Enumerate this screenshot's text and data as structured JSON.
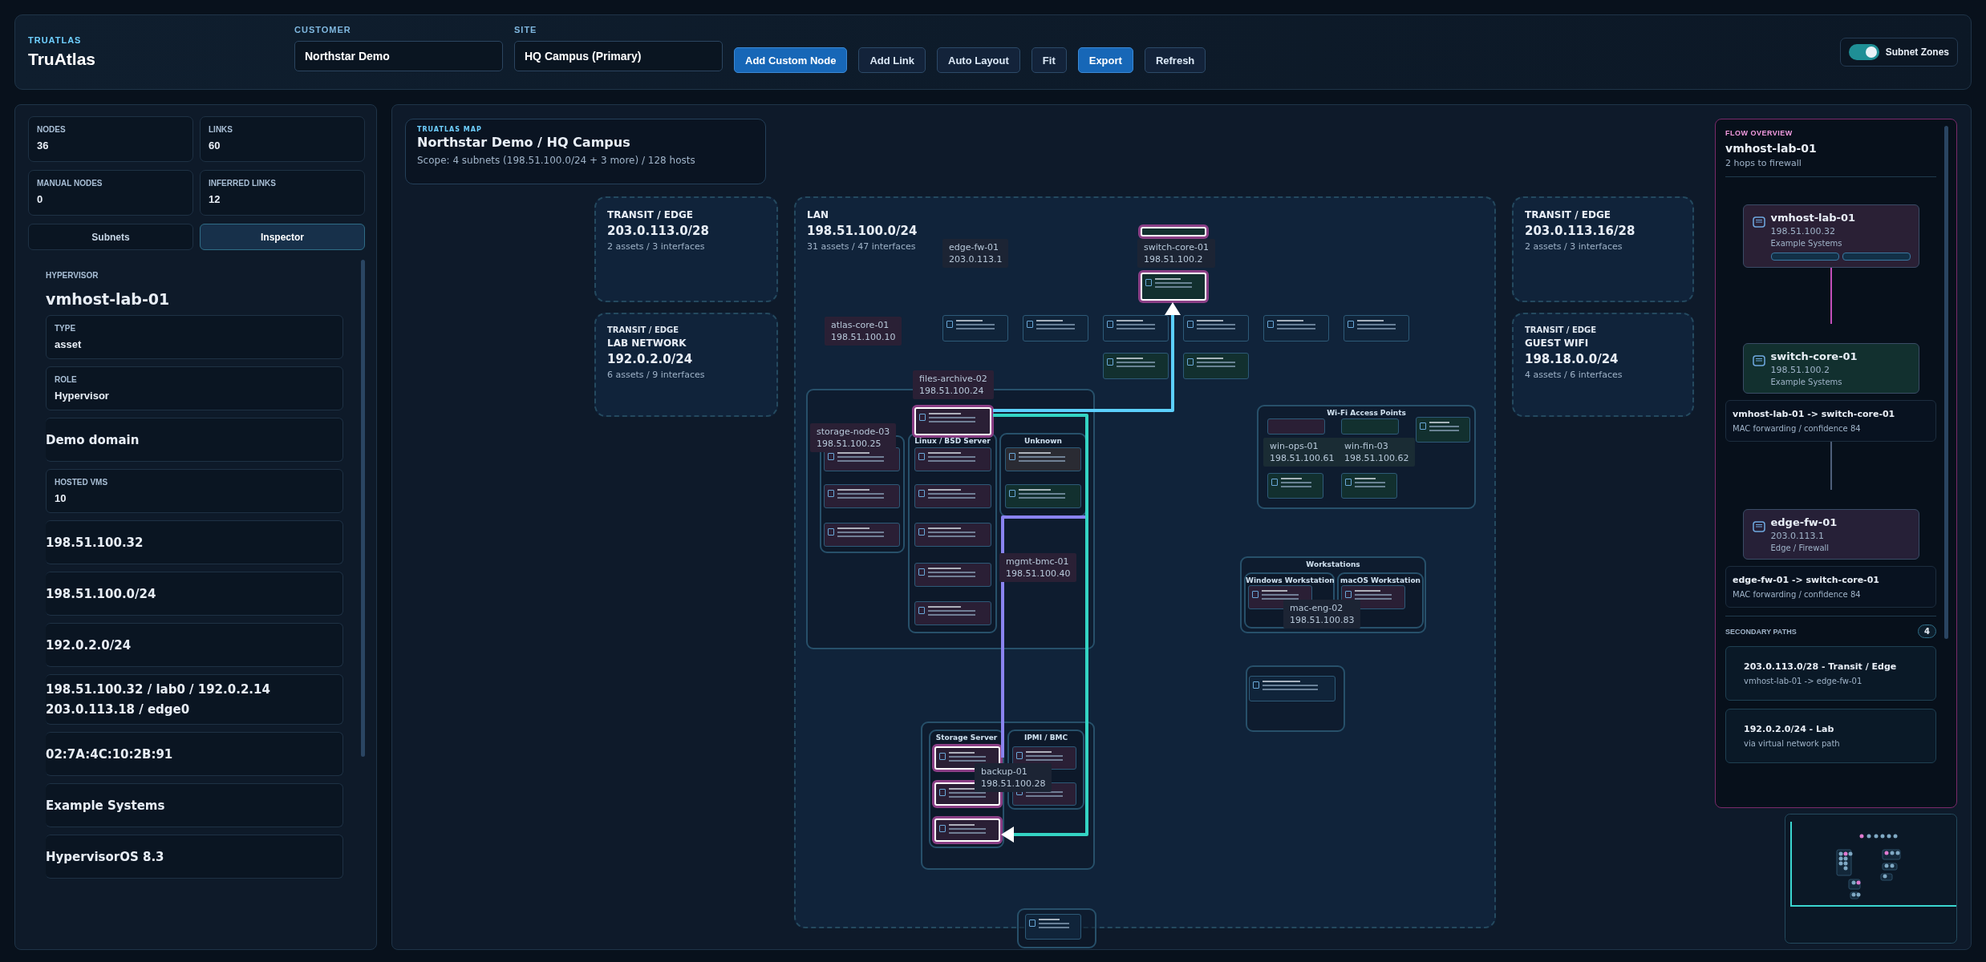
{
  "app": {
    "brand": "TRUATLAS",
    "title": "TruAtlas"
  },
  "filters": [
    {
      "label": "CUSTOMER",
      "value": "Northstar Demo"
    },
    {
      "label": "SITE",
      "value": "HQ Campus (Primary)"
    }
  ],
  "toolbar": [
    {
      "label": "Add Custom Node",
      "primary": true
    },
    {
      "label": "Add Link",
      "primary": false
    },
    {
      "label": "Auto Layout",
      "primary": false
    },
    {
      "label": "Fit",
      "primary": false
    },
    {
      "label": "Export",
      "primary": true
    },
    {
      "label": "Refresh",
      "primary": false
    }
  ],
  "subnet_zones": {
    "label": "Subnet Zones",
    "on": true
  },
  "stats": [
    {
      "label": "NODES",
      "value": "36"
    },
    {
      "label": "LINKS",
      "value": "60"
    },
    {
      "label": "MANUAL NODES",
      "value": "0"
    },
    {
      "label": "INFERRED LINKS",
      "value": "12"
    }
  ],
  "panel_tabs": [
    {
      "label": "Subnets",
      "selected": false
    },
    {
      "label": "Inspector",
      "selected": true
    }
  ],
  "inspector": {
    "kind_label": "HYPERVISOR",
    "name": "vmhost-lab-01",
    "fields": [
      {
        "label": "TYPE",
        "values": [
          "asset"
        ]
      },
      {
        "label": "ROLE",
        "values": [
          "Hypervisor"
        ]
      },
      {
        "values": [
          "Demo domain"
        ]
      },
      {
        "label": "HOSTED VMS",
        "values": [
          "10"
        ]
      },
      {
        "values": [
          "198.51.100.32"
        ]
      },
      {
        "values": [
          "198.51.100.0/24"
        ]
      },
      {
        "values": [
          "192.0.2.0/24"
        ]
      },
      {
        "values": [
          "198.51.100.32 / lab0 / 192.0.2.14",
          "203.0.113.18 / edge0"
        ]
      },
      {
        "values": [
          "02:7A:4C:10:2B:91"
        ]
      },
      {
        "values": [
          "Example Systems"
        ]
      },
      {
        "values": [
          "HypervisorOS 8.3"
        ]
      }
    ]
  },
  "map": {
    "header": {
      "eyebrow": "TRUATLAS MAP",
      "title": "Northstar Demo / HQ Campus",
      "scope": "Scope: 4 subnets (198.51.100.0/24 + 3 more) / 128 hosts"
    },
    "zones": [
      {
        "tag": "TRANSIT / EDGE",
        "network": "203.0.113.0/28",
        "summary": "2 assets / 3 interfaces"
      },
      {
        "overlay_tag": "TRANSIT / EDGE",
        "tag": "LAB NETWORK",
        "network": "192.0.2.0/24",
        "summary": "6 assets / 9 interfaces"
      },
      {
        "tag": "LAN",
        "network": "198.51.100.0/24",
        "summary": "31 assets / 47 interfaces"
      },
      {
        "tag": "TRANSIT / EDGE",
        "network": "203.0.113.16/28",
        "summary": "2 assets / 3 interfaces"
      },
      {
        "overlay_tag": "TRANSIT / EDGE",
        "tag": "GUEST WIFI",
        "network": "198.18.0.0/24",
        "summary": "4 assets / 6 interfaces"
      }
    ],
    "groups": [
      {
        "kind": "frame"
      },
      {
        "kind": "frame"
      },
      {
        "kind": "titled",
        "title": "Linux / BSD Server"
      },
      {
        "kind": "titled",
        "title": "Unknown"
      },
      {
        "kind": "titled",
        "title": "Wi-Fi Access Points"
      },
      {
        "kind": "titled",
        "title": "Workstations"
      },
      {
        "kind": "titled",
        "title": "Windows Workstation"
      },
      {
        "kind": "titled",
        "title": "macOS Workstation"
      },
      {
        "kind": "frame"
      },
      {
        "kind": "frame"
      },
      {
        "kind": "titled",
        "title": "Storage Server"
      },
      {
        "kind": "titled",
        "title": "IPMI / BMC"
      },
      {
        "kind": "frame"
      }
    ],
    "devices": [
      {
        "color": "#12302f",
        "highlighted": true
      },
      {
        "color": "#12302f",
        "highlighted": true
      },
      {
        "color": "#10243a",
        "highlighted": false
      },
      {
        "color": "#10243a",
        "highlighted": false
      },
      {
        "color": "#10243a",
        "highlighted": false
      },
      {
        "color": "#10243a",
        "highlighted": false
      },
      {
        "color": "#10243a",
        "highlighted": false
      },
      {
        "color": "#10243a",
        "highlighted": false
      },
      {
        "color": "#12302f",
        "highlighted": false
      },
      {
        "color": "#12302f",
        "highlighted": false
      },
      {
        "color": "#2a1f35",
        "highlighted": true
      },
      {
        "color": "#2a1f35",
        "highlighted": false
      },
      {
        "color": "#2a1f35",
        "highlighted": false
      },
      {
        "color": "#2a1f35",
        "highlighted": false
      },
      {
        "color": "#2a1f35",
        "highlighted": false
      },
      {
        "color": "#2a1f35",
        "highlighted": false
      },
      {
        "color": "#2a1f35",
        "highlighted": false
      },
      {
        "color": "#2a1f35",
        "highlighted": false
      },
      {
        "color": "#2a1f35",
        "highlighted": false
      },
      {
        "color": "#2a2b33",
        "highlighted": false
      },
      {
        "color": "#12302f",
        "highlighted": false
      },
      {
        "color": "#2a1f35",
        "highlighted": false
      },
      {
        "color": "#12302f",
        "highlighted": false
      },
      {
        "color": "#12302f",
        "highlighted": false
      },
      {
        "color": "#12302f",
        "highlighted": false
      },
      {
        "color": "#12302f",
        "highlighted": false
      },
      {
        "color": "#2a1f35",
        "highlighted": false
      },
      {
        "color": "#2a1f35",
        "highlighted": false
      },
      {
        "color": "#10243a",
        "highlighted": false
      },
      {
        "color": "#2a1f35",
        "highlighted": true
      },
      {
        "color": "#2a1f35",
        "highlighted": true
      },
      {
        "color": "#2a1f35",
        "highlighted": true
      },
      {
        "color": "#2a1f35",
        "highlighted": false
      },
      {
        "color": "#2a1f35",
        "highlighted": false
      },
      {
        "color": "#10243a",
        "highlighted": false
      }
    ],
    "tooltips": [
      {
        "name": "edge-fw-01",
        "ip": "203.0.113.1",
        "color": "#1c2434"
      },
      {
        "name": "switch-core-01",
        "ip": "198.51.100.2",
        "color": "#1c2434"
      },
      {
        "name": "atlas-core-01",
        "ip": "198.51.100.10",
        "color": "#2a2035"
      },
      {
        "name": "files-archive-02",
        "ip": "198.51.100.24",
        "color": "#2a2035"
      },
      {
        "name": "storage-node-03",
        "ip": "198.51.100.25",
        "color": "#2a2035"
      },
      {
        "name": "mgmt-bmc-01",
        "ip": "198.51.100.40",
        "color": "#2a2035"
      },
      {
        "name": "win-ops-01",
        "ip": "198.51.100.61",
        "color": "#1a2c34"
      },
      {
        "name": "win-fin-03",
        "ip": "198.51.100.62",
        "color": "#1a2c34"
      },
      {
        "name": "mac-eng-02",
        "ip": "198.51.100.83",
        "color": "#1c2434"
      },
      {
        "name": "backup-01",
        "ip": "198.51.100.28",
        "color": "#1c2434"
      }
    ]
  },
  "flow": {
    "eyebrow": "FLOW OVERVIEW",
    "title": "vmhost-lab-01",
    "subtitle": "2 hops to firewall",
    "steps": [
      {
        "kind": "node",
        "name": "vmhost-lab-01",
        "ip": "198.51.100.32",
        "detail": "Example Systems",
        "color": "#2a2035"
      },
      {
        "kind": "node",
        "name": "switch-core-01",
        "ip": "198.51.100.2",
        "detail": "Example Systems",
        "color": "#12302f"
      },
      {
        "kind": "link",
        "title": "vmhost-lab-01 -> switch-core-01",
        "detail": "MAC forwarding / confidence 84"
      },
      {
        "kind": "node",
        "name": "edge-fw-01",
        "ip": "203.0.113.1",
        "detail": "Edge / Firewall",
        "color": "#262037"
      },
      {
        "kind": "link",
        "title": "edge-fw-01 -> switch-core-01",
        "detail": "MAC forwarding / confidence 84"
      }
    ],
    "secondary_label": "SECONDARY PATHS",
    "secondary_count": "4",
    "paths": [
      {
        "title": "203.0.113.0/28 - Transit / Edge",
        "detail": "vmhost-lab-01 -> edge-fw-01"
      },
      {
        "title": "192.0.2.0/24 - Lab",
        "detail": "via virtual network path"
      }
    ]
  }
}
